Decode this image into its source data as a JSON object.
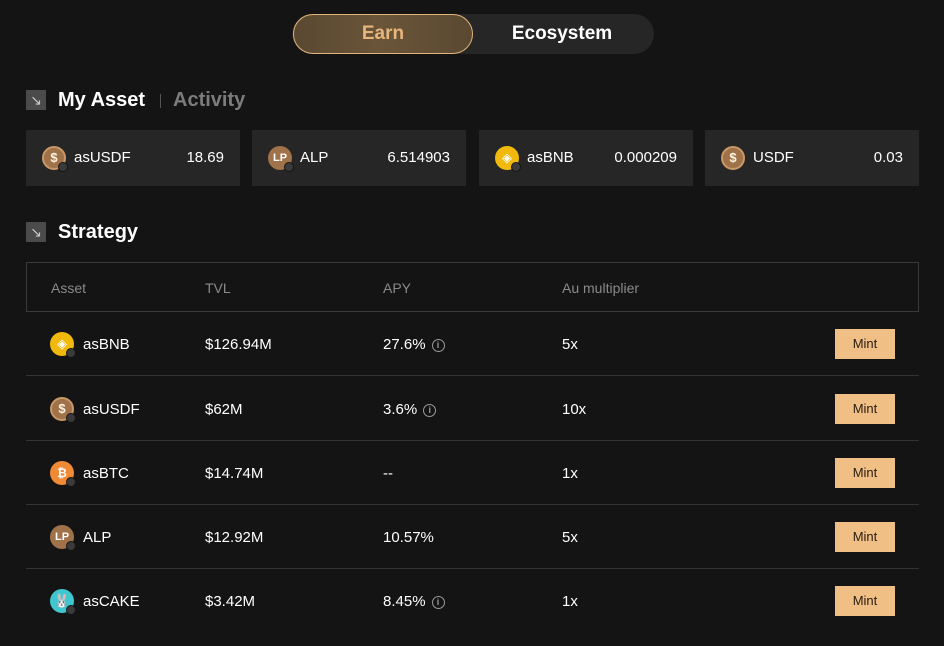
{
  "tabs": {
    "earn": "Earn",
    "ecosystem": "Ecosystem"
  },
  "my_asset": {
    "title": "My Asset",
    "activity": "Activity",
    "cards": [
      {
        "name": "asUSDF",
        "amount": "18.69",
        "icon": "usdf-coin-icon",
        "glyph": "$"
      },
      {
        "name": "ALP",
        "amount": "6.514903",
        "icon": "alp-coin-icon",
        "glyph": "LP"
      },
      {
        "name": "asBNB",
        "amount": "0.000209",
        "icon": "bnb-coin-icon",
        "glyph": "◈"
      },
      {
        "name": "USDF",
        "amount": "0.03",
        "icon": "usdf-coin-icon",
        "glyph": "$"
      }
    ]
  },
  "strategy": {
    "title": "Strategy",
    "columns": {
      "asset": "Asset",
      "tvl": "TVL",
      "apy": "APY",
      "multiplier": "Au multiplier"
    },
    "rows": [
      {
        "asset": "asBNB",
        "tvl": "$126.94M",
        "apy": "27.6%",
        "multiplier": "5x",
        "action": "Mint",
        "glyph": "◈"
      },
      {
        "asset": "asUSDF",
        "tvl": "$62M",
        "apy": "3.6%",
        "multiplier": "10x",
        "action": "Mint",
        "glyph": "$"
      },
      {
        "asset": "asBTC",
        "tvl": "$14.74M",
        "apy": "--",
        "multiplier": "1x",
        "action": "Mint",
        "glyph": "₿"
      },
      {
        "asset": "ALP",
        "tvl": "$12.92M",
        "apy": "10.57%",
        "multiplier": "5x",
        "action": "Mint",
        "glyph": "LP"
      },
      {
        "asset": "asCAKE",
        "tvl": "$3.42M",
        "apy": "8.45%",
        "multiplier": "1x",
        "action": "Mint",
        "glyph": "🐰"
      }
    ]
  },
  "colors": {
    "accent": "#f0bf86",
    "background": "#141414",
    "card": "#262626"
  }
}
